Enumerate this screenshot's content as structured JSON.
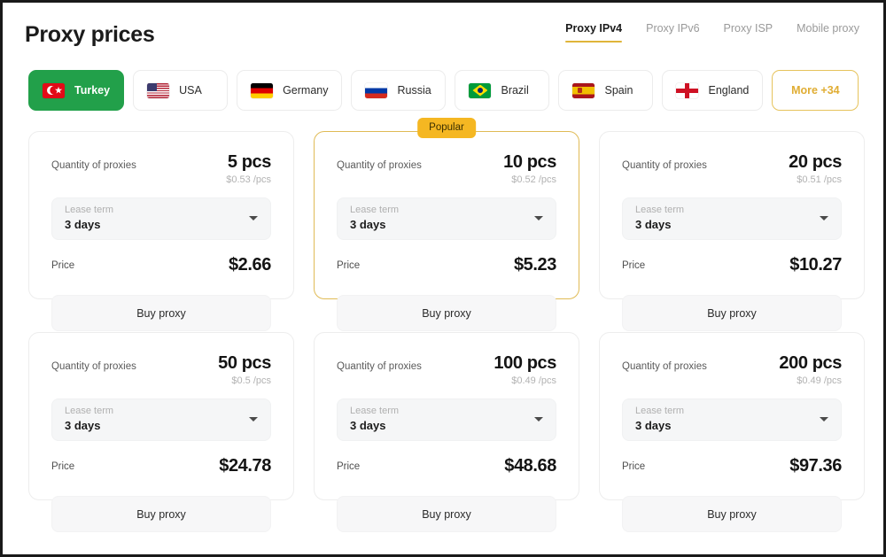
{
  "header": {
    "title": "Proxy prices",
    "tabs": [
      {
        "label": "Proxy IPv4",
        "active": true
      },
      {
        "label": "Proxy IPv6",
        "active": false
      },
      {
        "label": "Proxy ISP",
        "active": false
      },
      {
        "label": "Mobile proxy",
        "active": false
      }
    ],
    "accent_color": "#e0b53a"
  },
  "countries": [
    {
      "label": "Turkey",
      "flag": "flag-tr",
      "flag_name": "turkey-flag-icon",
      "active": true,
      "more": false
    },
    {
      "label": "USA",
      "flag": "flag-us",
      "flag_name": "usa-flag-icon",
      "active": false,
      "more": false
    },
    {
      "label": "Germany",
      "flag": "flag-de",
      "flag_name": "germany-flag-icon",
      "active": false,
      "more": false
    },
    {
      "label": "Russia",
      "flag": "flag-ru",
      "flag_name": "russia-flag-icon",
      "active": false,
      "more": false
    },
    {
      "label": "Brazil",
      "flag": "flag-br",
      "flag_name": "brazil-flag-icon",
      "active": false,
      "more": false
    },
    {
      "label": "Spain",
      "flag": "flag-es",
      "flag_name": "spain-flag-icon",
      "active": false,
      "more": false
    },
    {
      "label": "England",
      "flag": "flag-en",
      "flag_name": "england-flag-icon",
      "active": false,
      "more": false
    },
    {
      "label": "More +34",
      "flag": null,
      "flag_name": null,
      "active": false,
      "more": true
    }
  ],
  "colors": {
    "active_country": "#22a04a",
    "popular_badge": "#f5b722",
    "popular_border": "#e0bb55",
    "more_border": "#e6c35c",
    "more_text": "#e0ad33"
  },
  "labels": {
    "quantity": "Quantity of proxies",
    "lease_term": "Lease term",
    "price": "Price",
    "buy": "Buy proxy",
    "popular_badge": "Popular"
  },
  "cards": [
    {
      "quantity": "5 pcs",
      "unit_price": "$0.53 /pcs",
      "lease_term": "3 days",
      "price": "$2.66",
      "popular": false
    },
    {
      "quantity": "10 pcs",
      "unit_price": "$0.52 /pcs",
      "lease_term": "3 days",
      "price": "$5.23",
      "popular": true
    },
    {
      "quantity": "20 pcs",
      "unit_price": "$0.51 /pcs",
      "lease_term": "3 days",
      "price": "$10.27",
      "popular": false
    },
    {
      "quantity": "50 pcs",
      "unit_price": "$0.5 /pcs",
      "lease_term": "3 days",
      "price": "$24.78",
      "popular": false
    },
    {
      "quantity": "100 pcs",
      "unit_price": "$0.49 /pcs",
      "lease_term": "3 days",
      "price": "$48.68",
      "popular": false
    },
    {
      "quantity": "200 pcs",
      "unit_price": "$0.49 /pcs",
      "lease_term": "3 days",
      "price": "$97.36",
      "popular": false
    }
  ]
}
